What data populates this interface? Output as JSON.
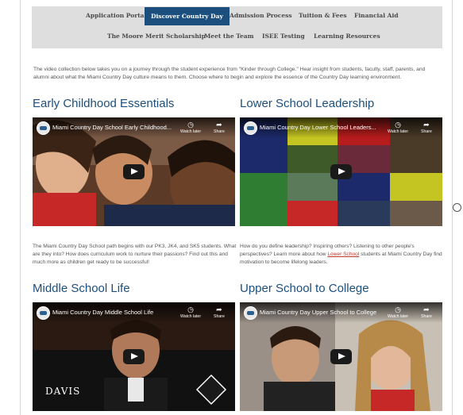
{
  "nav": {
    "row1": [
      "Application Portal",
      "Discover Country Day",
      "Admission Process",
      "Tuition & Fees",
      "Financial Aid"
    ],
    "row2": [
      "The Moore Merit Scholarship",
      "Meet the Team",
      "ISEE Testing",
      "Learning Resources"
    ],
    "active": "Discover Country Day"
  },
  "intro": "The video collection below takes you on a journey through the student experience from \"Kinder through College.\" Hear insight from students, faculty, staff, parents, and alumni about what the Miami Country Day culture means to them. Choose where to begin and explore the essence of the Country Day learning environment.",
  "sections": [
    {
      "title": "Early Childhood Essentials",
      "video_title": "Miami Country Day School Early Childhood...",
      "watch_later": "Watch later",
      "share": "Share",
      "desc": "The Miami Country Day School path begins with our PK3, JK4, and SK5 students. What are they into? How does curriculum work to nurture their passions? Find out this and much more as children get ready to be successful!"
    },
    {
      "title": "Lower School Leadership",
      "video_title": "Miami Country Day Lower School Leaders...",
      "watch_later": "Watch later",
      "share": "Share",
      "desc_before": "How do you define leadership? Inspiring others? Listening to other people's perspectives? Learn more about how ",
      "desc_link": "Lower School",
      "desc_after": " students at Miami Country Day find motivation to become lifelong leaders."
    },
    {
      "title": "Middle School Life",
      "video_title": "Miami Country Day Middle School Life",
      "watch_later": "Watch later",
      "share": "Share",
      "caption": "DAVIS"
    },
    {
      "title": "Upper School to College",
      "video_title": "Miami Country Day Upper School to College",
      "watch_later": "Watch later",
      "share": "Share"
    }
  ],
  "colors": {
    "accent": "#1c4f7d",
    "nav_bg": "#dedede",
    "link": "#c0392b"
  },
  "icons": {
    "watch_later": "clock-icon",
    "share": "share-arrow-icon",
    "play": "play-icon",
    "side": "circle-icon"
  }
}
